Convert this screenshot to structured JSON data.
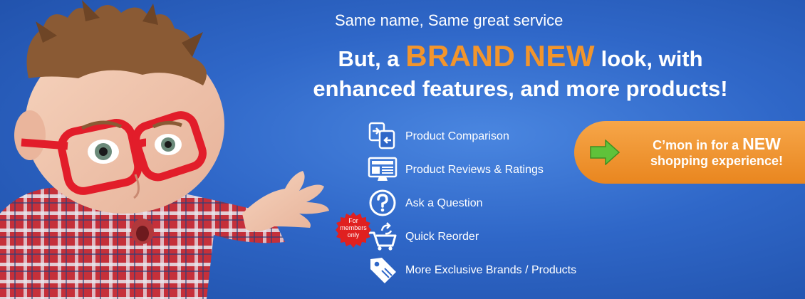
{
  "tagline": "Same name, Same great service",
  "headline": {
    "prefix": "But, a",
    "highlight": "BRAND NEW",
    "suffix": "look, with",
    "line2": "enhanced features, and more products!"
  },
  "features": [
    {
      "label": "Product Comparison",
      "icon": "compare-icon"
    },
    {
      "label": "Product Reviews & Ratings",
      "icon": "reviews-monitor-icon",
      "icon_text": "REVIEWS"
    },
    {
      "label": "Ask a Question",
      "icon": "question-icon"
    },
    {
      "label": "Quick Reorder",
      "icon": "cart-reorder-icon"
    },
    {
      "label": "More Exclusive Brands / Products",
      "icon": "tag-icon"
    }
  ],
  "badge": {
    "line1": "For",
    "line2": "members",
    "line3": "only",
    "color": "#e02020"
  },
  "cta": {
    "line1_prefix": "C’mon in for a",
    "line1_highlight": "NEW",
    "line2": "shopping experience!",
    "color": "#ef8e25",
    "arrow_color": "#5fc23a"
  },
  "colors": {
    "background": "#2f67c8",
    "accent": "#f2952c"
  }
}
